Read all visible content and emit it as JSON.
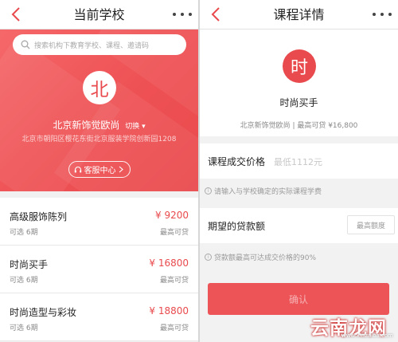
{
  "left": {
    "nav_title": "当前学校",
    "search_placeholder": "搜索机构下教育学校、课程、邀请码",
    "school_logo_char": "北",
    "school_name": "北京新饰觉欧尚",
    "switch_label": "切换",
    "school_address": "北京市朝阳区樱花东街北京服装学院创新园1208",
    "service_label": "客服中心",
    "courses": [
      {
        "name": "高级服饰陈列",
        "sub": "可选 6期",
        "price": "¥ 9200",
        "price_sub": "最高可贷"
      },
      {
        "name": "时尚买手",
        "sub": "可选 6期",
        "price": "¥ 16800",
        "price_sub": "最高可贷"
      },
      {
        "name": "时尚造型与彩妆",
        "sub": "可选 6期",
        "price": "¥ 18800",
        "price_sub": "最高可贷"
      }
    ]
  },
  "right": {
    "nav_title": "课程详情",
    "course_logo_char": "时",
    "course_name": "时尚买手",
    "course_meta": "北京新饰觉欧尚 | 最高可贷 ¥16,800",
    "price_label": "课程成交价格",
    "price_value": "最低1112元",
    "price_hint": "请输入与学校确定的实际课程学费",
    "loan_label": "期望的贷款额",
    "loan_max_label": "最高额度",
    "loan_hint": "贷款额最高可达成交价格的90%",
    "confirm_label": "确认"
  },
  "watermark": {
    "text": "云南龙网",
    "url": "www.xiazaiba.com"
  },
  "colors": {
    "accent": "#e94a4d",
    "background": "#f1f1f1"
  }
}
